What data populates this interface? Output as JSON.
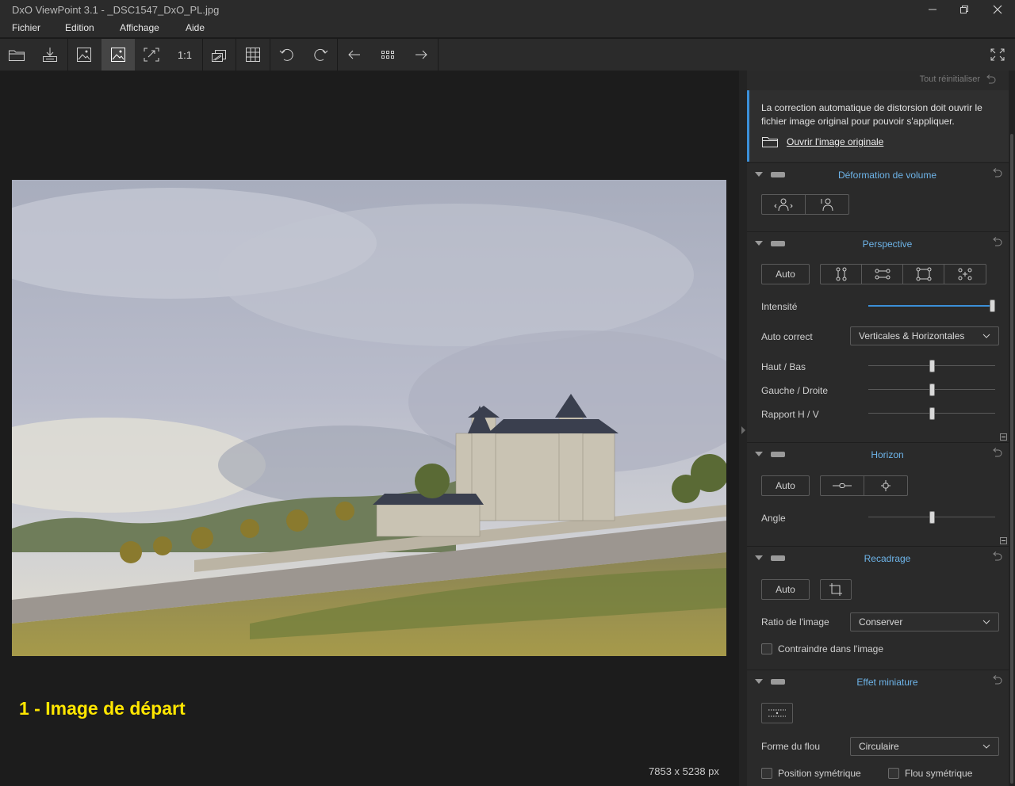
{
  "window": {
    "title": "DxO ViewPoint 3.1 - _DSC1547_DxO_PL.jpg",
    "controls": [
      "minimize-icon",
      "restore-icon",
      "close-icon"
    ]
  },
  "menu": [
    "Fichier",
    "Edition",
    "Affichage",
    "Aide"
  ],
  "toolbar": {
    "one_to_one": "1:1",
    "icons": [
      "open-folder-icon",
      "export-icon",
      "image-original-icon",
      "image-corrected-icon",
      "fit-screen-icon",
      "actual-size-icon",
      "compare-icon",
      "grid-icon",
      "rotate-left-icon",
      "rotate-right-icon",
      "previous-icon",
      "filmstrip-icon",
      "next-icon",
      "fullscreen-icon"
    ]
  },
  "viewer": {
    "caption": "1 - Image de départ",
    "dimensions": "7853 x 5238 px"
  },
  "panel": {
    "reset_all": "Tout réinitialiser",
    "info_text": "La correction automatique de distorsion doit ouvrir le fichier image original pour pouvoir s'appliquer.",
    "open_original": "Ouvrir l'image originale",
    "volume": {
      "title": "Déformation de volume"
    },
    "perspective": {
      "title": "Perspective",
      "auto": "Auto",
      "intensity_label": "Intensité",
      "intensity_value": 1.0,
      "auto_correct_label": "Auto correct",
      "auto_correct_value": "Verticales & Horizontales",
      "haut_bas_label": "Haut / Bas",
      "gauche_droite_label": "Gauche / Droite",
      "rapport_label": "Rapport H / V",
      "haut_bas_value": 0.5,
      "gauche_droite_value": 0.5,
      "rapport_value": 0.5
    },
    "horizon": {
      "title": "Horizon",
      "auto": "Auto",
      "angle_label": "Angle",
      "angle_value": 0.5
    },
    "recadrage": {
      "title": "Recadrage",
      "auto": "Auto",
      "ratio_label": "Ratio de l'image",
      "ratio_value": "Conserver",
      "constrain_label": "Contraindre dans l'image"
    },
    "miniature": {
      "title": "Effet miniature",
      "blur_shape_label": "Forme du flou",
      "blur_shape_value": "Circulaire",
      "sym_position_label": "Position symétrique",
      "sym_blur_label": "Flou symétrique"
    }
  }
}
